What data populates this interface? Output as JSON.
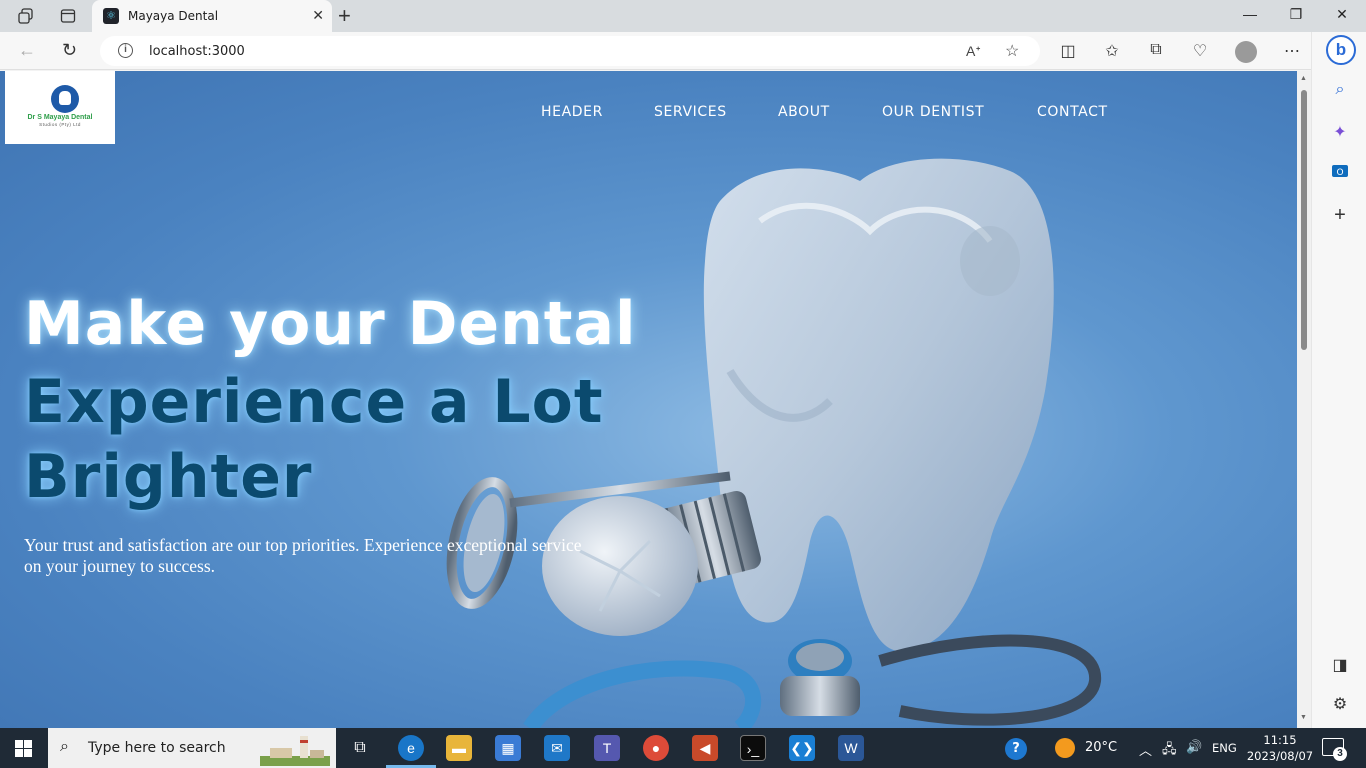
{
  "browser": {
    "tab_title": "Mayaya Dental",
    "url": "localhost:3000"
  },
  "site": {
    "logo": {
      "name": "Dr S Mayaya Dental",
      "subtitle": "Studios (Pty) Ltd"
    },
    "nav": [
      "HEADER",
      "SERVICES",
      "ABOUT",
      "OUR DENTIST",
      "CONTACT"
    ],
    "hero": {
      "line1": "Make your Dental",
      "line2": "Experience a Lot",
      "line3": "Brighter",
      "subtitle": "Your trust and satisfaction are our top priorities. Experience exceptional service on your journey to success."
    }
  },
  "taskbar": {
    "search_placeholder": "Type here to search",
    "weather": "20°C",
    "language": "ENG",
    "time": "11:15",
    "date": "2023/08/07",
    "notifications": "3"
  },
  "colors": {
    "hero_dark_text": "#0b4a6e",
    "logo_green": "#2e9e4a",
    "logo_blue": "#1e5aa8"
  }
}
